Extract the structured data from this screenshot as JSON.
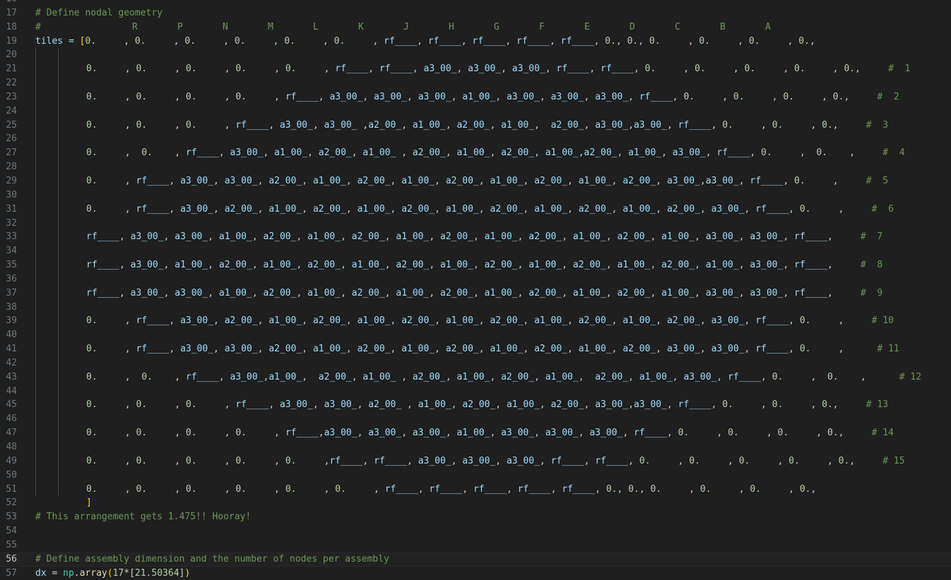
{
  "editor": {
    "current_line": 56,
    "lines": [
      {
        "no": 16,
        "kind": "blank"
      },
      {
        "no": 17,
        "kind": "comment",
        "text": "# Define nodal geometry"
      },
      {
        "no": 18,
        "kind": "header",
        "text": "#",
        "letters": [
          "R",
          "P",
          "N",
          "M",
          "L",
          "K",
          "J",
          "H",
          "G",
          "F",
          "E",
          "D",
          "C",
          "B",
          "A"
        ]
      },
      {
        "no": 19,
        "kind": "code",
        "prefix": "tiles = ",
        "bracket": "[",
        "text": "0.     , 0.     , 0.     , 0.     , 0.     , 0.     , rf____, rf____, rf____, rf____, rf____, 0., 0., 0.     , 0.     , 0.     , 0.,"
      },
      {
        "no": 20,
        "kind": "blank"
      },
      {
        "no": 21,
        "kind": "row",
        "text": "0.     , 0.     , 0.     , 0.     , 0.     , rf____, rf____, a3_00_, a3_00_, a3_00_, rf____, rf____, 0.     , 0.     , 0.     , 0.     , 0.,",
        "comment": "#  1"
      },
      {
        "no": 22,
        "kind": "blank"
      },
      {
        "no": 23,
        "kind": "row",
        "text": "0.     , 0.     , 0.     , 0.     , rf____, a3_00_, a3_00_, a3_00_, a1_00_, a3_00_, a3_00_, a3_00_, rf____, 0.     , 0.     , 0.     , 0.,",
        "comment": "#  2"
      },
      {
        "no": 24,
        "kind": "blank"
      },
      {
        "no": 25,
        "kind": "row",
        "text": "0.     , 0.     , 0.     , rf____, a3_00_, a3_00_ ,a2_00_, a1_00_, a2_00_, a1_00_,  a2_00_, a3_00_,a3_00_, rf____, 0.     , 0.     , 0.,",
        "comment": "#  3"
      },
      {
        "no": 26,
        "kind": "blank"
      },
      {
        "no": 27,
        "kind": "row",
        "text": "0.     ,  0.    , rf____, a3_00_, a1_00_, a2_00_, a1_00_ , a2_00_, a1_00_, a2_00_, a1_00_,a2_00_, a1_00_, a3_00_, rf____, 0.     ,  0.    ,",
        "comment": "#  4"
      },
      {
        "no": 28,
        "kind": "blank"
      },
      {
        "no": 29,
        "kind": "row",
        "text": "0.     , rf____, a3_00_, a3_00_, a2_00_, a1_00_, a2_00_, a1_00_, a2_00_, a1_00_, a2_00_, a1_00_, a2_00_, a3_00_,a3_00_, rf____, 0.     ,",
        "comment": "#  5"
      },
      {
        "no": 30,
        "kind": "blank"
      },
      {
        "no": 31,
        "kind": "row",
        "text": "0.     , rf____, a3_00_, a2_00_, a1_00_, a2_00_, a1_00_, a2_00_, a1_00_, a2_00_, a1_00_, a2_00_, a1_00_, a2_00_, a3_00_, rf____, 0.     ,",
        "comment": "#  6"
      },
      {
        "no": 32,
        "kind": "blank"
      },
      {
        "no": 33,
        "kind": "row",
        "text": "rf____, a3_00_, a3_00_, a1_00_, a2_00_, a1_00_, a2_00_, a1_00_, a2_00_, a1_00_, a2_00_, a1_00_, a2_00_, a1_00_, a3_00_, a3_00_, rf____,",
        "comment": "#  7"
      },
      {
        "no": 34,
        "kind": "blank"
      },
      {
        "no": 35,
        "kind": "row",
        "text": "rf____, a3_00_, a1_00_, a2_00_, a1_00_, a2_00_, a1_00_, a2_00_, a1_00_, a2_00_, a1_00_, a2_00_, a1_00_, a2_00_, a1_00_, a3_00_, rf____,",
        "comment": "#  8"
      },
      {
        "no": 36,
        "kind": "blank"
      },
      {
        "no": 37,
        "kind": "row",
        "text": "rf____, a3_00_, a3_00_, a1_00_, a2_00_, a1_00_, a2_00_, a1_00_, a2_00_, a1_00_, a2_00_, a1_00_, a2_00_, a1_00_, a3_00_, a3_00_, rf____,",
        "comment": "#  9"
      },
      {
        "no": 38,
        "kind": "blank"
      },
      {
        "no": 39,
        "kind": "row",
        "text": "0.     , rf____, a3_00_, a2_00_, a1_00_, a2_00_, a1_00_, a2_00_, a1_00_, a2_00_, a1_00_, a2_00_, a1_00_, a2_00_, a3_00_, rf____, 0.     ,",
        "comment": "# 10"
      },
      {
        "no": 40,
        "kind": "blank"
      },
      {
        "no": 41,
        "kind": "row",
        "text": "0.     , rf____, a3_00_, a3_00_, a2_00_, a1_00_, a2_00_, a1_00_, a2_00_, a1_00_, a2_00_, a1_00_, a2_00_, a3_00_, a3_00_, rf____, 0.     ,",
        "comment": " # 11"
      },
      {
        "no": 42,
        "kind": "blank"
      },
      {
        "no": 43,
        "kind": "row",
        "text": "0.     ,  0.    , rf____, a3_00_,a1_00_,  a2_00_, a1_00_ , a2_00_, a1_00_, a2_00_, a1_00_,  a2_00_, a1_00_, a3_00_, rf____, 0.     ,  0.    ,",
        "comment": " # 12"
      },
      {
        "no": 44,
        "kind": "blank"
      },
      {
        "no": 45,
        "kind": "row",
        "text": "0.     , 0.     , 0.     , rf____, a3_00_, a3_00_, a2_00_ , a1_00_, a2_00_, a1_00_, a2_00_, a3_00_,a3_00_, rf____, 0.     , 0.     , 0.,",
        "comment": "# 13"
      },
      {
        "no": 46,
        "kind": "blank"
      },
      {
        "no": 47,
        "kind": "row",
        "text": "0.     , 0.     , 0.     , 0.     , rf____,a3_00_, a3_00_, a3_00_, a1_00_, a3_00_, a3_00_, a3_00_, rf____, 0.     , 0.     , 0.     , 0.,",
        "comment": "# 14"
      },
      {
        "no": 48,
        "kind": "blank"
      },
      {
        "no": 49,
        "kind": "row",
        "text": "0.     , 0.     , 0.     , 0.     , 0.     ,rf____, rf____, a3_00_, a3_00_, a3_00_, rf____, rf____, 0.     , 0.     , 0.     , 0.     , 0.,",
        "comment": "# 15"
      },
      {
        "no": 50,
        "kind": "blank"
      },
      {
        "no": 51,
        "kind": "row",
        "text": "0.     , 0.     , 0.     , 0.     , 0.     , 0.     , rf____, rf____, rf____, rf____, rf____, 0., 0., 0.     , 0.     , 0.     , 0.,",
        "comment": ""
      },
      {
        "no": 52,
        "kind": "close",
        "text": "]"
      },
      {
        "no": 53,
        "kind": "comment",
        "text": "# This arrangement gets 1.475!! Hooray!"
      },
      {
        "no": 54,
        "kind": "blank"
      },
      {
        "no": 55,
        "kind": "blank"
      },
      {
        "no": 56,
        "kind": "comment",
        "text": "# Define assembly dimension and the number of nodes per assembly"
      },
      {
        "no": 57,
        "kind": "dx",
        "text": "dx = np.array(17*[21.50364])"
      }
    ]
  },
  "colors": {
    "background": "#1f1f1f",
    "line_number": "#6e7681",
    "comment": "#6a9955",
    "variable": "#9cdcfe",
    "number": "#b5cea8",
    "bracket": "#ffd700"
  }
}
